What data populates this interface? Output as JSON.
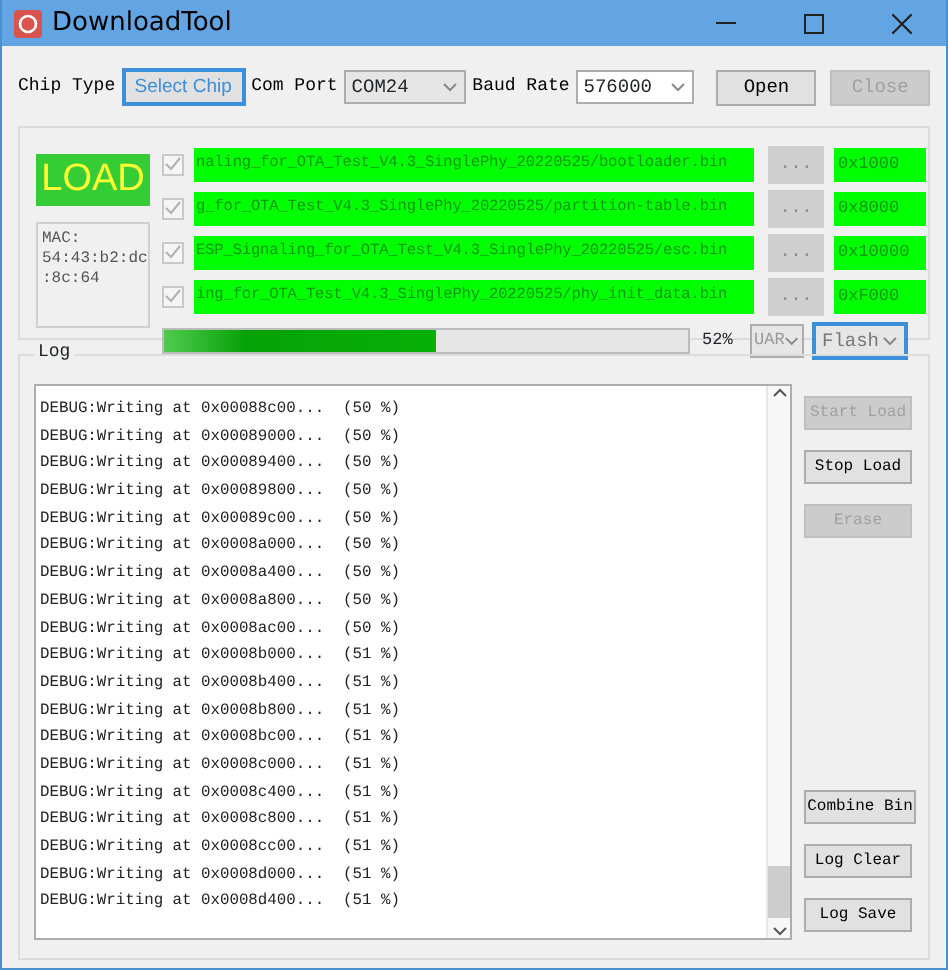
{
  "window": {
    "title": "DownloadTool"
  },
  "toolbar": {
    "chip_type_label": "Chip Type",
    "select_chip": "Select Chip",
    "com_port_label": "Com Port",
    "com_port": "COM24",
    "baud_rate_label": "Baud Rate",
    "baud_rate": "576000",
    "open": {
      "label": "Open",
      "disabled": false
    },
    "close": {
      "label": "Close",
      "disabled": true
    }
  },
  "load": {
    "label": "LOAD",
    "mac_lines": [
      "MAC:",
      "54:43:b2:dc",
      ":8c:64"
    ]
  },
  "files": [
    {
      "checked": true,
      "path": "naling_for_OTA_Test_V4.3_SinglePhy_20220525/bootloader.bin",
      "browse": "...",
      "address": "0x1000"
    },
    {
      "checked": true,
      "path": "g_for_OTA_Test_V4.3_SinglePhy_20220525/partition-table.bin",
      "browse": "...",
      "address": "0x8000"
    },
    {
      "checked": true,
      "path": "ESP_Signaling_for_OTA_Test_V4.3_SinglePhy_20220525/esc.bin",
      "browse": "...",
      "address": "0x10000"
    },
    {
      "checked": true,
      "path": "ing_for_OTA_Test_V4.3_SinglePhy_20220525/phy_init_data.bin",
      "browse": "...",
      "address": "0xF000"
    }
  ],
  "progress": {
    "level": 0.52,
    "reading": "52%"
  },
  "interface": {
    "value": "UAR",
    "disabled": true
  },
  "target": {
    "value": "Flash",
    "focused": true
  },
  "log": {
    "title": "Log",
    "lines": [
      "DEBUG:Writing at 0x00088c00...  (50 %)",
      "DEBUG:Writing at 0x00089000...  (50 %)",
      "DEBUG:Writing at 0x00089400...  (50 %)",
      "DEBUG:Writing at 0x00089800...  (50 %)",
      "DEBUG:Writing at 0x00089c00...  (50 %)",
      "DEBUG:Writing at 0x0008a000...  (50 %)",
      "DEBUG:Writing at 0x0008a400...  (50 %)",
      "DEBUG:Writing at 0x0008a800...  (50 %)",
      "DEBUG:Writing at 0x0008ac00...  (50 %)",
      "DEBUG:Writing at 0x0008b000...  (51 %)",
      "DEBUG:Writing at 0x0008b400...  (51 %)",
      "DEBUG:Writing at 0x0008b800...  (51 %)",
      "DEBUG:Writing at 0x0008bc00...  (51 %)",
      "DEBUG:Writing at 0x0008c000...  (51 %)",
      "DEBUG:Writing at 0x0008c400...  (51 %)",
      "DEBUG:Writing at 0x0008c800...  (51 %)",
      "DEBUG:Writing at 0x0008cc00...  (51 %)",
      "DEBUG:Writing at 0x0008d000...  (51 %)",
      "DEBUG:Writing at 0x0008d400...  (51 %)"
    ],
    "top_buttons": [
      {
        "label": "Start Load",
        "disabled": true
      },
      {
        "label": "Stop Load",
        "disabled": false
      },
      {
        "label": "Erase",
        "disabled": true
      }
    ],
    "bottom_buttons": [
      {
        "label": "Combine Bin",
        "disabled": false
      },
      {
        "label": "Log Clear",
        "disabled": false
      },
      {
        "label": "Log Save",
        "disabled": false
      }
    ]
  }
}
